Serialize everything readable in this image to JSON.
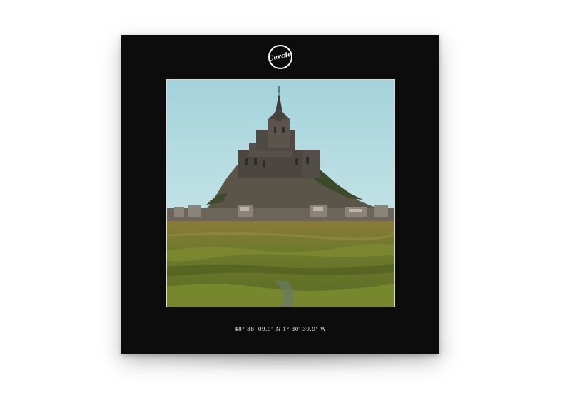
{
  "album": {
    "logo_text": "Cercle",
    "coordinates": "48° 38' 09.9\" N 1° 30' 39.9\" W",
    "photo_subject": "mont-saint-michel-photo"
  },
  "colors": {
    "sleeve": "#0c0c0c",
    "sky": "#9fd0d8",
    "grass": "#6f7d2a",
    "abbey": "#4b4740"
  }
}
